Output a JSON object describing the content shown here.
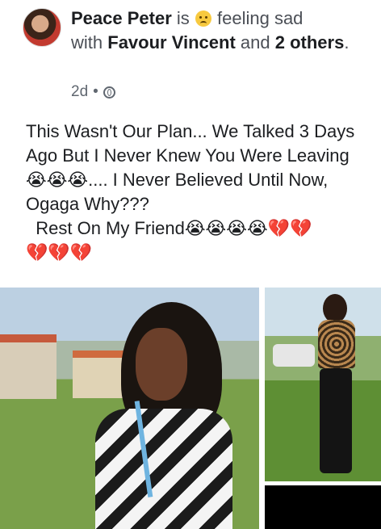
{
  "post": {
    "author": "Peace Peter",
    "is_text": " is ",
    "feeling_text": " feeling sad",
    "with_text": "with ",
    "tagged": "Favour Vincent",
    "and_text": " and ",
    "others": "2 others",
    "period": ".",
    "time": "2d",
    "separator": "•",
    "body": "This Wasn't Our Plan... We Talked 3 Days Ago But I Never Knew You Were Leaving😭😭😭.... I Never Believed Until Now, Ogaga Why???\n  Rest On My Friend😭😭😭😭💔💔\n💔💔💔"
  },
  "icons": {
    "feeling": "sad-face-icon",
    "privacy": "globe-icon"
  }
}
